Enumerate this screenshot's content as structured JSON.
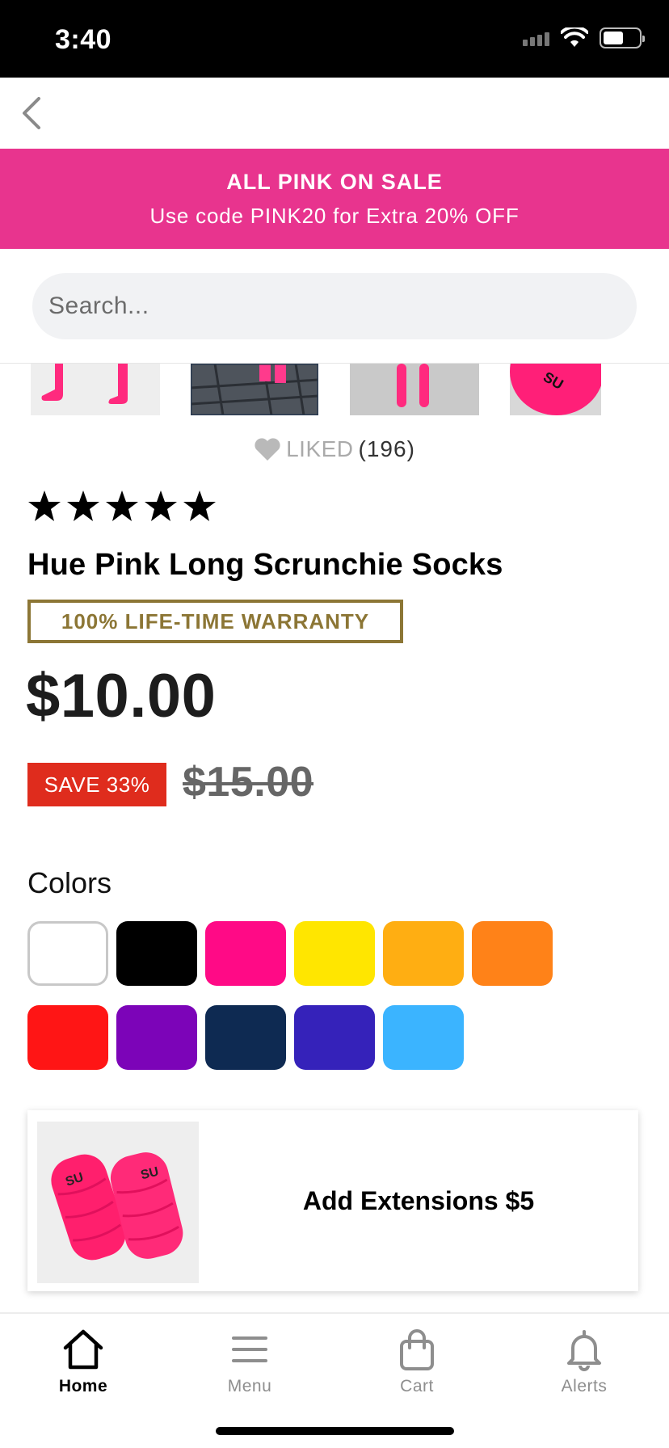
{
  "status_bar": {
    "time": "3:40"
  },
  "promo": {
    "title": "ALL PINK ON SALE",
    "subtitle": "Use code PINK20 for Extra 20% OFF",
    "background_color": "#e8348e"
  },
  "search": {
    "placeholder": "Search..."
  },
  "liked": {
    "label": "LIKED",
    "count": "(196)"
  },
  "rating": {
    "stars": 5,
    "max": 5
  },
  "product": {
    "title": "Hue Pink Long Scrunchie Socks",
    "warranty": "100% LIFE-TIME WARRANTY",
    "price": "$10.00",
    "save_badge": "SAVE 33%",
    "original_price": "$15.00"
  },
  "colors": {
    "label": "Colors",
    "swatches": [
      {
        "name": "white",
        "hex": "#ffffff",
        "selected": true
      },
      {
        "name": "black",
        "hex": "#000000",
        "selected": false
      },
      {
        "name": "hot-pink",
        "hex": "#ff0a86",
        "selected": false
      },
      {
        "name": "yellow",
        "hex": "#ffe600",
        "selected": false
      },
      {
        "name": "gold",
        "hex": "#ffae12",
        "selected": false
      },
      {
        "name": "orange",
        "hex": "#ff8218",
        "selected": false
      },
      {
        "name": "red",
        "hex": "#ff1515",
        "selected": false
      },
      {
        "name": "purple",
        "hex": "#7c04b8",
        "selected": false
      },
      {
        "name": "navy",
        "hex": "#0e2a52",
        "selected": false
      },
      {
        "name": "royal-blue",
        "hex": "#3522ba",
        "selected": false
      },
      {
        "name": "sky-blue",
        "hex": "#3bb4ff",
        "selected": false
      }
    ]
  },
  "extension": {
    "label": "Add Extensions $5"
  },
  "tab_bar": {
    "items": [
      {
        "label": "Home",
        "icon": "home-icon",
        "active": true
      },
      {
        "label": "Menu",
        "icon": "menu-icon",
        "active": false
      },
      {
        "label": "Cart",
        "icon": "cart-icon",
        "active": false
      },
      {
        "label": "Alerts",
        "icon": "bell-icon",
        "active": false
      }
    ]
  }
}
